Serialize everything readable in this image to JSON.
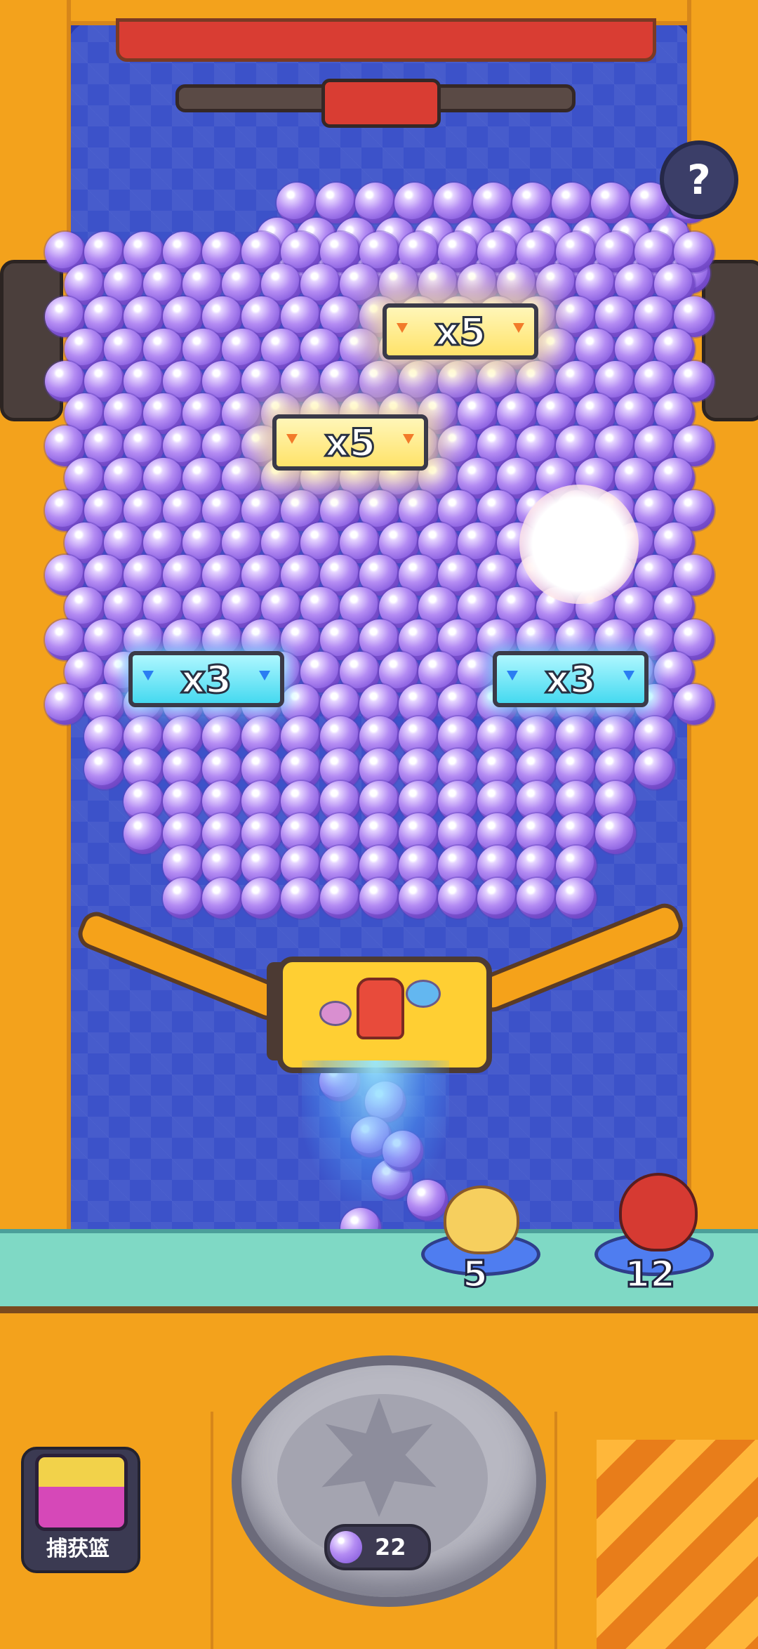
{
  "multipliers": [
    {
      "label": "x5",
      "style": "gold"
    },
    {
      "label": "x5",
      "style": "gold"
    },
    {
      "label": "x3",
      "style": "cyan"
    },
    {
      "label": "x3",
      "style": "cyan"
    }
  ],
  "help": {
    "label": "?"
  },
  "pets": [
    {
      "name": "yellow-hamster",
      "count": "5"
    },
    {
      "name": "red-fire-bird",
      "count": "12"
    }
  ],
  "ball_counter": {
    "value": "22"
  },
  "basket": {
    "label": "捕获篮"
  },
  "colors": {
    "cabinet": "#f3a21c",
    "playfield": "#3c52c9",
    "ball": "#8a5fe0",
    "floor": "#7fd9c5"
  },
  "icons": {
    "help": "question-mark-icon",
    "ball": "paw-ball-icon",
    "basket": "basket-icon"
  }
}
